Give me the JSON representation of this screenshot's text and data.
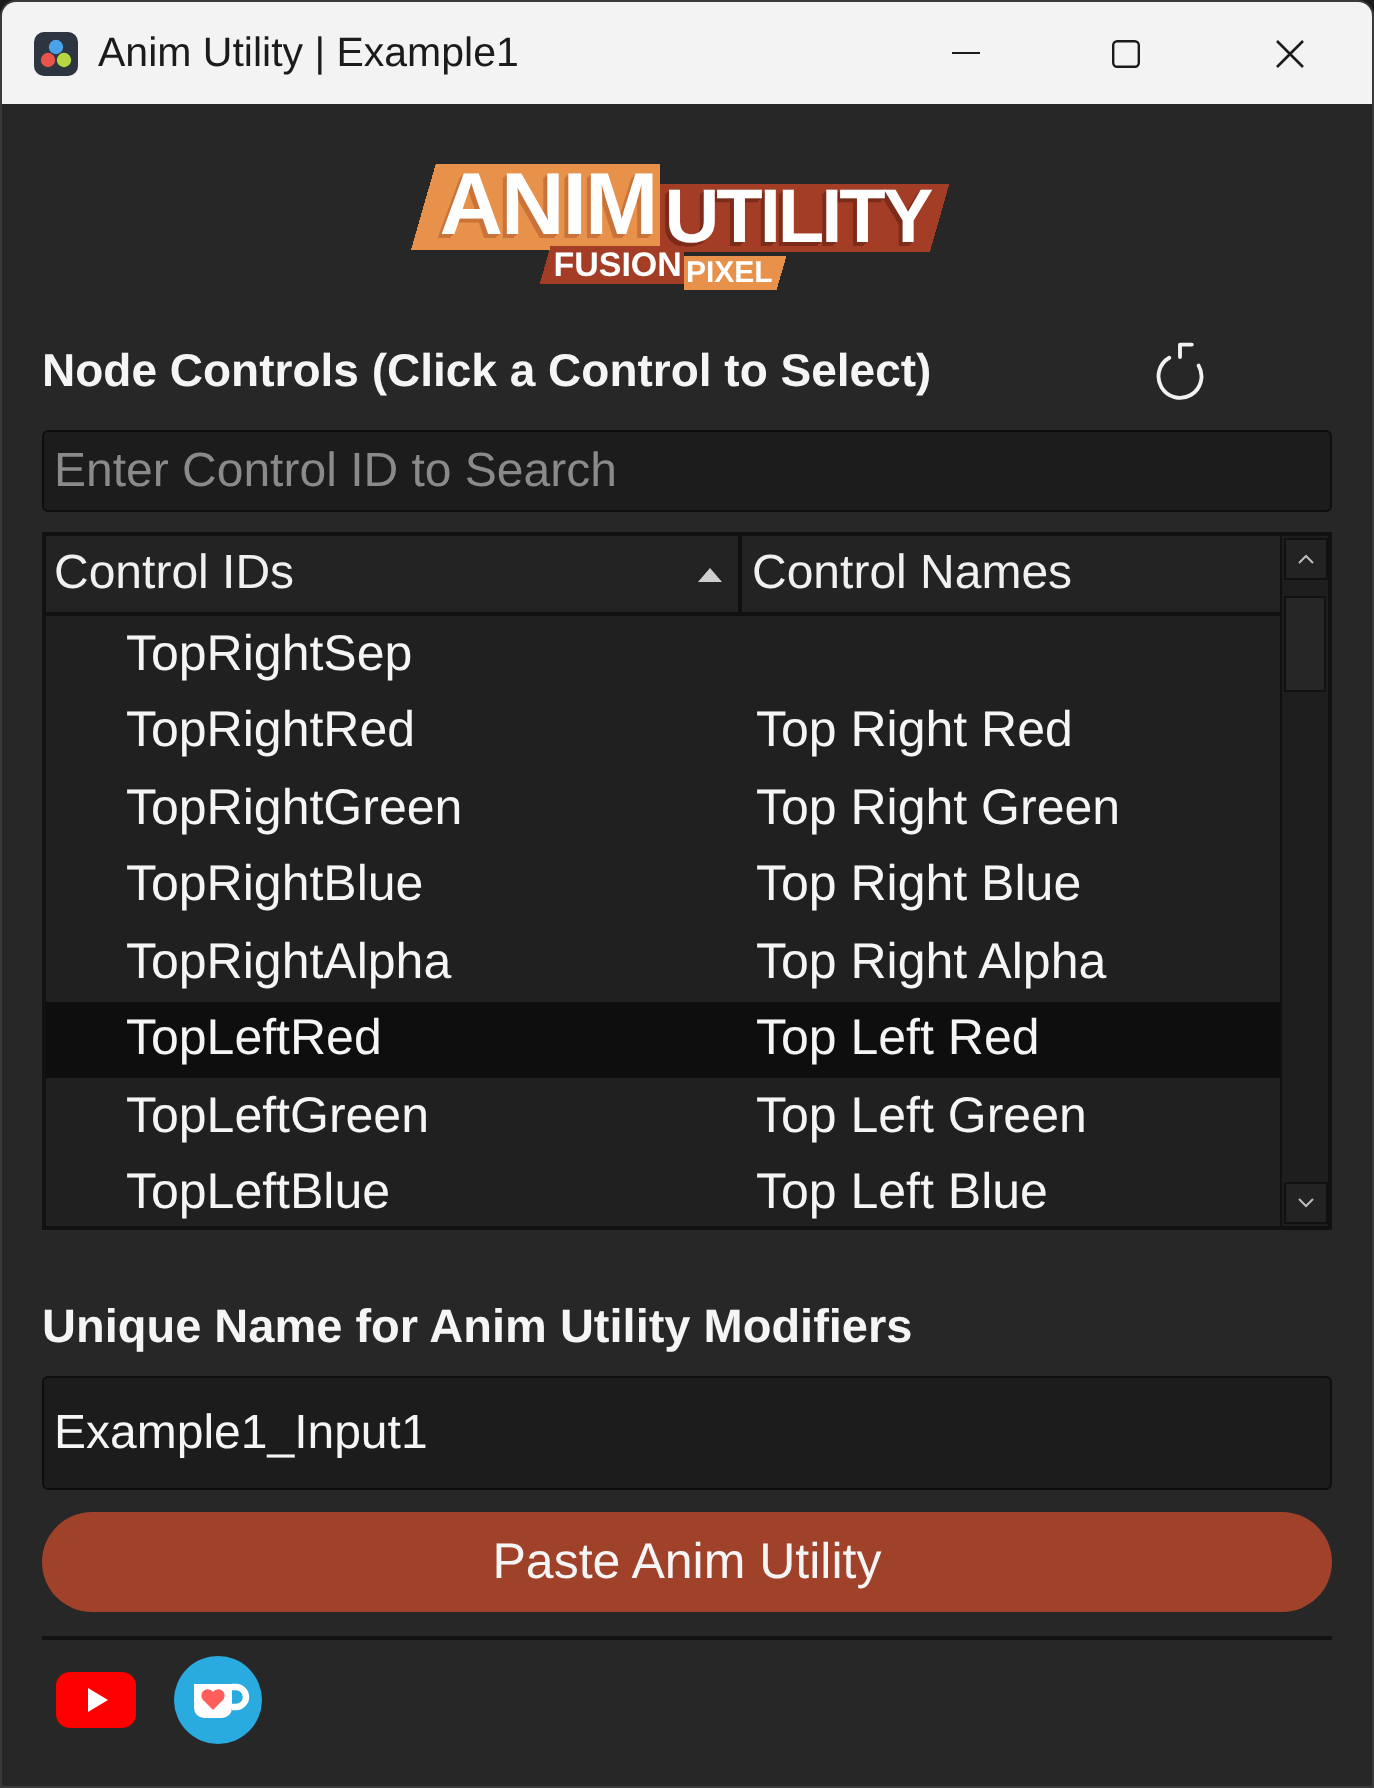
{
  "window": {
    "title": "Anim Utility | Example1"
  },
  "logo": {
    "title_1": "ANIM",
    "title_2": "UTILITY",
    "subtitle_1": "FUSION",
    "subtitle_2": "PIXEL"
  },
  "node_controls": {
    "heading": "Node Controls (Click a Control to Select)"
  },
  "search": {
    "placeholder": "Enter Control ID to Search"
  },
  "table": {
    "columns": [
      {
        "label": "Control IDs",
        "sorted": true
      },
      {
        "label": "Control Names",
        "sorted": false
      }
    ],
    "rows": [
      {
        "id": "TopRightSep",
        "selected": false
      },
      {
        "id": "TopRightRed",
        "name": "Top Right Red",
        "selected": false
      },
      {
        "id": "TopRightGreen",
        "name": "Top Right Green",
        "selected": false
      },
      {
        "id": "TopRightBlue",
        "name": "Top Right Blue",
        "selected": false
      },
      {
        "id": "TopRightAlpha",
        "name": "Top Right Alpha",
        "selected": false
      },
      {
        "id": "TopLeftRed",
        "name": "Top Left Red",
        "selected": true
      },
      {
        "id": "TopLeftGreen",
        "name": "Top Left Green",
        "selected": false
      },
      {
        "id": "TopLeftBlue",
        "name": "Top Left Blue",
        "selected": false
      }
    ]
  },
  "unique_name": {
    "label": "Unique Name for Anim Utility Modifiers",
    "value": "Example1_Input1"
  },
  "paste_button": {
    "label": "Paste Anim Utility"
  }
}
